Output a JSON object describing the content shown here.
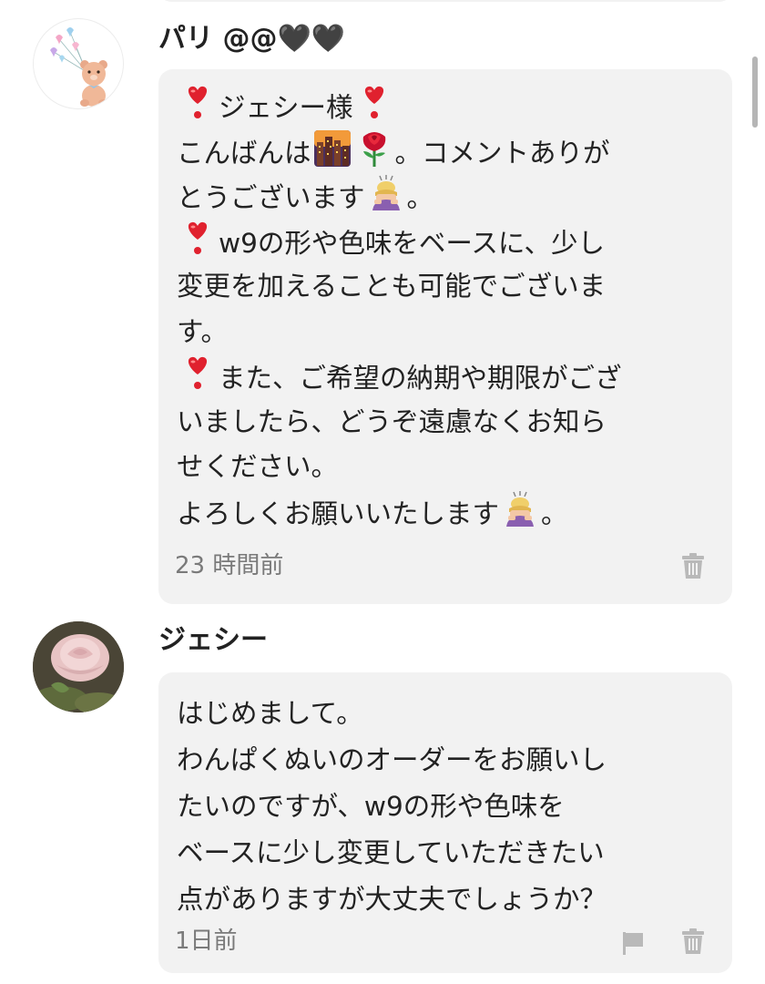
{
  "comments": [
    {
      "username": "パリ @@🖤🖤",
      "avatar_icon": "teddy-bear-balloons-icon",
      "lines": [
        [
          "emoji:heart-exclamation",
          "ジェシー様",
          "emoji:heart-exclamation"
        ],
        [
          "こんばんは",
          "emoji:city-sunset",
          "emoji:rose",
          "。コメントありが"
        ],
        [
          "とうございます",
          "emoji:bowing-person",
          "。"
        ],
        [
          "emoji:heart-exclamation",
          "w9の形や色味をベースに、少し"
        ],
        [
          "変更を加えることも可能でございま"
        ],
        [
          "す。"
        ],
        [
          "emoji:heart-exclamation",
          "また、ご希望の納期や期限がござ"
        ],
        [
          "いましたら、どうぞ遠慮なくお知ら"
        ],
        [
          "せください。"
        ],
        [
          "よろしくお願いいたします",
          "emoji:bowing-person",
          "。"
        ]
      ],
      "time": "23 時間前",
      "actions": [
        "trash-icon"
      ]
    },
    {
      "username": "ジェシー",
      "avatar_icon": "pink-rose-photo-icon",
      "lines": [
        [
          "はじめまして。"
        ],
        [
          "わんぱくぬいのオーダーをお願いし"
        ],
        [
          "たいのですが、w9の形や色味を"
        ],
        [
          "ベースに少し変更していただきたい"
        ],
        [
          "点がありますが大丈夫でしょうか？"
        ]
      ],
      "time": "1日前",
      "actions": [
        "flag-icon",
        "trash-icon"
      ]
    }
  ],
  "colors": {
    "bubble_bg": "#f2f2f2",
    "text": "#222222",
    "meta": "#7a7a7a",
    "icon": "#b9b9b9"
  }
}
